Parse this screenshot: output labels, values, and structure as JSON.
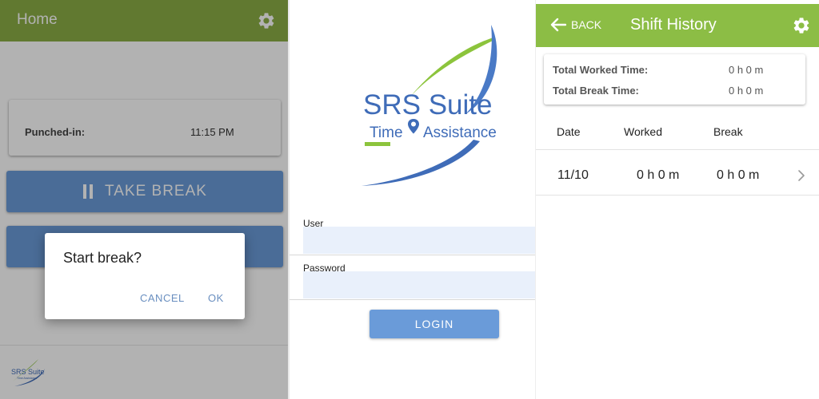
{
  "home": {
    "title": "Home",
    "punched_label": "Punched-in:",
    "punched_time": "11:15 PM",
    "take_break_label": "TAKE BREAK",
    "second_button_label": "",
    "dialog": {
      "message": "Start break?",
      "cancel_label": "CANCEL",
      "ok_label": "OK"
    },
    "footer_logo": {
      "text": "SRS Suite",
      "subtext": "Time Assistance"
    }
  },
  "login": {
    "logo": {
      "title": "SRS Suite",
      "subtitle_left": "Time",
      "subtitle_right": "Assistance"
    },
    "user_label": "User",
    "user_value": "",
    "password_label": "Password",
    "password_value": "",
    "login_label": "LOGIN"
  },
  "shift_history": {
    "back_label": "BACK",
    "title": "Shift History",
    "total_worked_label": "Total Worked Time:",
    "total_worked_value": "0 h 0 m",
    "total_break_label": "Total Break Time:",
    "total_break_value": "0 h 0 m",
    "columns": [
      "Date",
      "Worked",
      "Break"
    ],
    "rows": [
      {
        "date": "11/10",
        "worked": "0 h 0 m",
        "break": "0 h 0 m"
      }
    ]
  },
  "colors": {
    "header_green": "#8cae45",
    "header_green_right": "#8cbd45",
    "button_blue": "#6a9bd9",
    "input_bg": "#e9f0fb",
    "logo_blue": "#3f6cb8",
    "logo_green": "#8cc43c"
  },
  "icons": {
    "settings": "gear-icon",
    "back": "arrow-left-icon",
    "row_chevron": "chevron-right-icon",
    "pause": "pause-icon"
  }
}
